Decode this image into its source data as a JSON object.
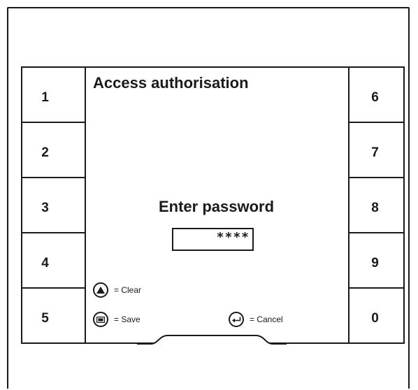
{
  "screen": {
    "title": "Access authorisation",
    "prompt": "Enter password",
    "password_value": "****"
  },
  "left_keys": [
    "1",
    "2",
    "3",
    "4",
    "5"
  ],
  "right_keys": [
    "6",
    "7",
    "8",
    "9",
    "0"
  ],
  "hints": {
    "clear": {
      "icon": "triangle-up-icon",
      "label": "= Clear"
    },
    "save": {
      "icon": "rectangle-icon",
      "label": "= Save"
    },
    "cancel": {
      "icon": "return-arrow-icon",
      "label": "= Cancel"
    }
  }
}
